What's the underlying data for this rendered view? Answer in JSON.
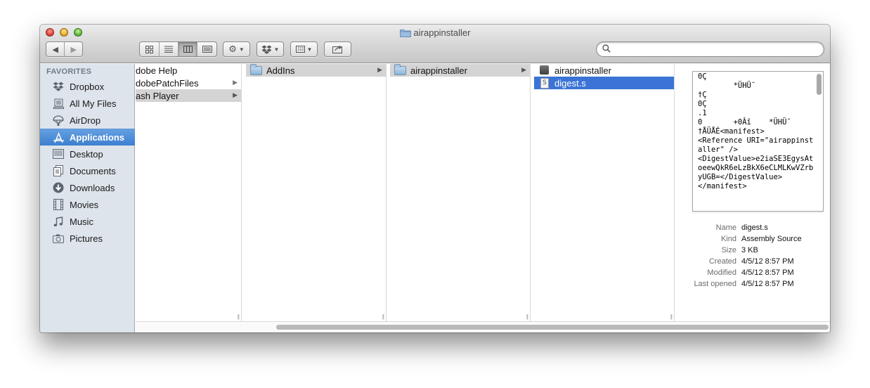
{
  "window": {
    "title": "airappinstaller"
  },
  "toolbar": {
    "back_icon": "back-arrow-icon",
    "forward_icon": "forward-arrow-icon",
    "view_modes": [
      "icon-view-icon",
      "list-view-icon",
      "column-view-icon",
      "coverflow-view-icon"
    ],
    "active_view": "column",
    "action_icon": "gear-icon",
    "dropbox_icon": "dropbox-icon",
    "arrange_icon": "arrange-icon",
    "share_icon": "share-icon",
    "search_placeholder": ""
  },
  "sidebar": {
    "header": "FAVORITES",
    "items": [
      {
        "label": "Dropbox",
        "icon": "dropbox-icon"
      },
      {
        "label": "All My Files",
        "icon": "all-files-icon"
      },
      {
        "label": "AirDrop",
        "icon": "airdrop-icon"
      },
      {
        "label": "Applications",
        "icon": "applications-icon",
        "selected": true
      },
      {
        "label": "Desktop",
        "icon": "desktop-icon"
      },
      {
        "label": "Documents",
        "icon": "documents-icon"
      },
      {
        "label": "Downloads",
        "icon": "downloads-icon"
      },
      {
        "label": "Movies",
        "icon": "movies-icon"
      },
      {
        "label": "Music",
        "icon": "music-icon"
      },
      {
        "label": "Pictures",
        "icon": "camera-icon"
      }
    ]
  },
  "columns": [
    {
      "items": [
        {
          "label": "dobe Help",
          "has_children": false
        },
        {
          "label": "dobePatchFiles",
          "has_children": true
        },
        {
          "label": "ash Player",
          "has_children": true,
          "highlighted": true
        }
      ]
    },
    {
      "items": [
        {
          "label": "AddIns",
          "icon": "folder-icon",
          "has_children": true,
          "highlighted": true
        }
      ]
    },
    {
      "items": [
        {
          "label": "airappinstaller",
          "icon": "folder-icon",
          "has_children": true,
          "highlighted": true
        }
      ]
    },
    {
      "items": [
        {
          "label": "airappinstaller",
          "icon": "executable-icon",
          "has_children": false
        },
        {
          "label": "digest.s",
          "icon": "source-file-icon",
          "has_children": false,
          "selected": true
        }
      ]
    }
  ],
  "preview": {
    "text": "0Ç\n        *ÜHÜ˘\n†Ç\n0Ç\n.1\n0       +0Âî    *ÜHÜ˘\n†ÅÜÅÉ<manifest>\n<Reference URI=\"airappinstaller\" />\n<DigestValue>e2iaSE3EgysAtoeewQkR6eLzBkX6eCLMLKwVZrbyUGB=</DigestValue>\n</manifest>",
    "info": [
      {
        "key": "Name",
        "value": "digest.s"
      },
      {
        "key": "Kind",
        "value": "Assembly Source"
      },
      {
        "key": "Size",
        "value": "3 KB"
      },
      {
        "key": "Created",
        "value": "4/5/12 8:57 PM"
      },
      {
        "key": "Modified",
        "value": "4/5/12 8:57 PM"
      },
      {
        "key": "Last opened",
        "value": "4/5/12 8:57 PM"
      }
    ]
  }
}
